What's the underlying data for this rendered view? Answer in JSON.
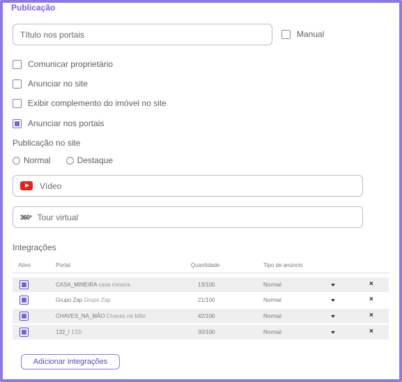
{
  "section_title": "Publicação",
  "title_input": {
    "placeholder": "Título nos portais",
    "value": ""
  },
  "manual": {
    "label": "Manual",
    "checked": false
  },
  "options": [
    {
      "label": "Comunicar proprietário",
      "checked": false
    },
    {
      "label": "Anunciar no site",
      "checked": false
    },
    {
      "label": "Exibir complemento do imóvel no site",
      "checked": false
    },
    {
      "label": "Anunciar nos portais",
      "checked": true
    }
  ],
  "site_publication": {
    "label": "Publicação no site",
    "radios": [
      {
        "label": "Normal",
        "selected": false
      },
      {
        "label": "Destaque",
        "selected": false
      }
    ]
  },
  "video_input": {
    "placeholder": "Vídeo",
    "icon": "youtube-icon"
  },
  "tour_input": {
    "placeholder": "Tour virtual",
    "icon": "tour-360-icon",
    "icon_text": "360°"
  },
  "integrations": {
    "label": "Integrações",
    "columns": [
      "Ativo",
      "Portal",
      "Quantidade",
      "Tipo de anúncio"
    ],
    "rows": [
      {
        "active": true,
        "portal": "CASA_MINEIRA",
        "portal_sub": "casa mineira",
        "quantity": "13/100",
        "type": "Normal"
      },
      {
        "active": true,
        "portal": "Grupo Zap",
        "portal_sub": "Grupo Zap",
        "quantity": "21/100",
        "type": "Normal"
      },
      {
        "active": true,
        "portal": "CHAVES_NA_MÃO",
        "portal_sub": "Chaves na Mão",
        "quantity": "42/100",
        "type": "Normal"
      },
      {
        "active": true,
        "portal": "132_I",
        "portal_sub": "132i",
        "quantity": "30/100",
        "type": "Normal"
      }
    ],
    "delete_symbol": "×",
    "add_button": "Adicionar Integrações"
  },
  "colors": {
    "accent": "#7b61d9",
    "border": "#8e78e6",
    "youtube": "#e62117"
  }
}
